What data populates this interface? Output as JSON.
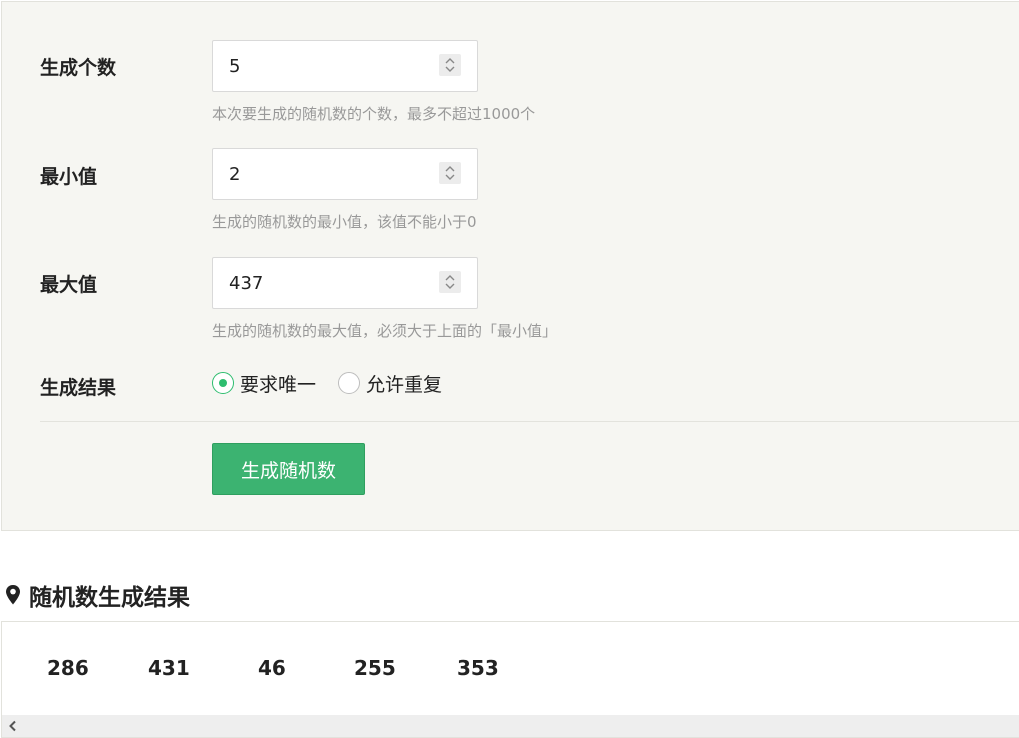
{
  "form": {
    "count": {
      "label": "生成个数",
      "value": "5",
      "help": "本次要生成的随机数的个数，最多不超过1000个"
    },
    "min": {
      "label": "最小值",
      "value": "2",
      "help": "生成的随机数的最小值，该值不能小于0"
    },
    "max": {
      "label": "最大值",
      "value": "437",
      "help": "生成的随机数的最大值，必须大于上面的「最小值」"
    },
    "result_mode": {
      "label": "生成结果",
      "options": [
        {
          "label": "要求唯一",
          "selected": true
        },
        {
          "label": "允许重复",
          "selected": false
        }
      ]
    },
    "generate_button": "生成随机数"
  },
  "results": {
    "heading": "随机数生成结果",
    "numbers": [
      "286",
      "431",
      "46",
      "255",
      "353"
    ]
  },
  "colors": {
    "accent": "#3cb371",
    "panel_bg": "#f6f6f2",
    "help_text": "#999999"
  },
  "icons": {
    "heading": "map-marker-icon",
    "spinner": "chevron-up-down-icon",
    "scroll": "chevron-left-icon"
  }
}
